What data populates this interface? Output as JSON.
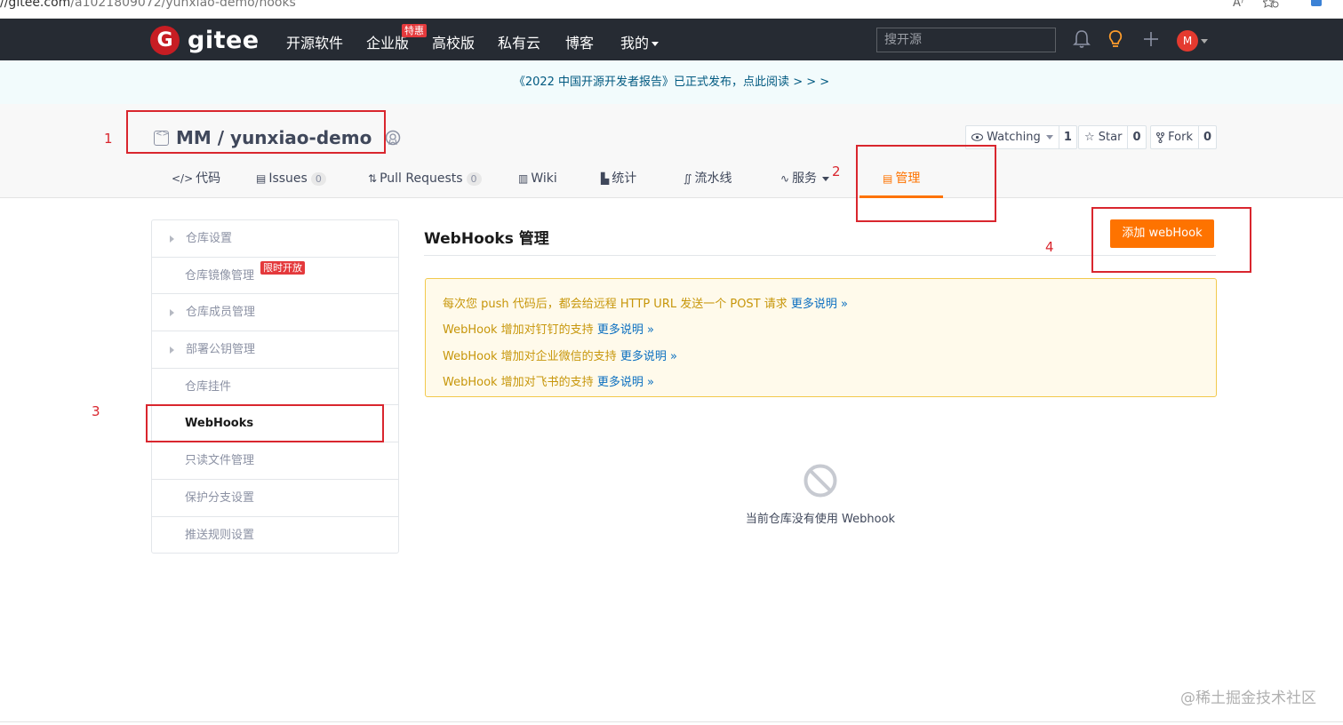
{
  "browser": {
    "url_host": "//gitee.com",
    "url_path": "/a1021809072/yunxiao-demo/hooks",
    "read_aloud_label": "A⁾"
  },
  "header": {
    "logo_glyph": "G",
    "logo_text": "gitee",
    "nav": [
      "开源软件",
      "企业版",
      "高校版",
      "私有云",
      "博客",
      "我的"
    ],
    "hot_badge": "特惠",
    "search_placeholder": "搜开源",
    "avatar_initial": "M",
    "bg_color": "#262b33"
  },
  "announcement": "《2022 中国开源开发者报告》已正式发布，点此阅读 > > >",
  "project": {
    "title": "MM / yunxiao-demo",
    "watch_label": "Watching",
    "watch_count": "1",
    "star_label": "Star",
    "star_count": "0",
    "fork_label": "Fork",
    "fork_count": "0",
    "tabs": [
      {
        "label": "代码",
        "icon": "</>"
      },
      {
        "label": "Issues",
        "count": "0"
      },
      {
        "label": "Pull Requests",
        "count": "0"
      },
      {
        "label": "Wiki"
      },
      {
        "label": "统计"
      },
      {
        "label": "流水线"
      },
      {
        "label": "服务"
      },
      {
        "label": "管理"
      }
    ]
  },
  "sidebar": {
    "items": [
      {
        "label": "仓库设置"
      },
      {
        "label": "仓库镜像管理",
        "badge": "限时开放"
      },
      {
        "label": "仓库成员管理"
      },
      {
        "label": "部署公钥管理"
      },
      {
        "label": "仓库挂件"
      },
      {
        "label": "WebHooks"
      },
      {
        "label": "只读文件管理"
      },
      {
        "label": "保护分支设置"
      },
      {
        "label": "推送规则设置"
      }
    ]
  },
  "main": {
    "title": "WebHooks 管理",
    "add_button": "添加 webHook",
    "notices": [
      {
        "text": "每次您 push 代码后，都会给远程 HTTP URL 发送一个 POST 请求 ",
        "link": "更多说明 »"
      },
      {
        "text": "WebHook 增加对钉钉的支持 ",
        "link": "更多说明 »"
      },
      {
        "text": "WebHook 增加对企业微信的支持 ",
        "link": "更多说明 »"
      },
      {
        "text": "WebHook 增加对飞书的支持 ",
        "link": "更多说明 »"
      }
    ],
    "empty_text": "当前仓库没有使用 Webhook",
    "accent_color": "#fe7300"
  },
  "annotations": [
    "1",
    "2",
    "3",
    "4"
  ],
  "watermark": "@稀土掘金技术社区"
}
